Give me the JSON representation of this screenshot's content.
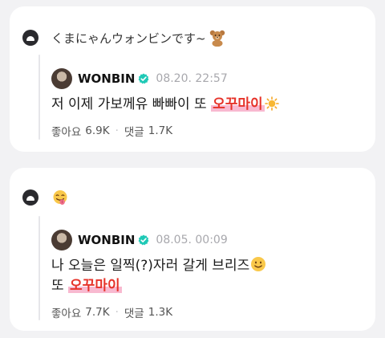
{
  "posts": [
    {
      "question": {
        "text": "くまにゃんウォンビンです~",
        "emoji": "teddy-bear-icon"
      },
      "reply": {
        "username": "WONBIN",
        "date": "08.20. 22:57",
        "text_before": "저 이제 가보께유 빠빠이 또 ",
        "highlight": "오꾸마이",
        "trailing_emoji": "sun-icon"
      },
      "stats": {
        "likes_label": "좋아요",
        "likes": "6.9K",
        "comments_label": "댓글",
        "comments": "1.7K"
      }
    },
    {
      "question": {
        "text": "",
        "emoji": "face-with-tongue-icon"
      },
      "reply": {
        "username": "WONBIN",
        "date": "08.05. 00:09",
        "line1": "나 오늘은 일찍(?)자러 갈게 브리즈",
        "line1_emoji": "smile-icon",
        "line2_before": "또 ",
        "highlight": "오꾸마이"
      },
      "stats": {
        "likes_label": "좋아요",
        "likes": "7.7K",
        "comments_label": "댓글",
        "comments": "1.3K"
      }
    }
  ],
  "colors": {
    "background": "#f2f2f4",
    "card": "#ffffff",
    "highlight_text": "#e6332a",
    "highlight_marker": "#f8b9d0",
    "verified_badge": "#1fc9b6"
  }
}
